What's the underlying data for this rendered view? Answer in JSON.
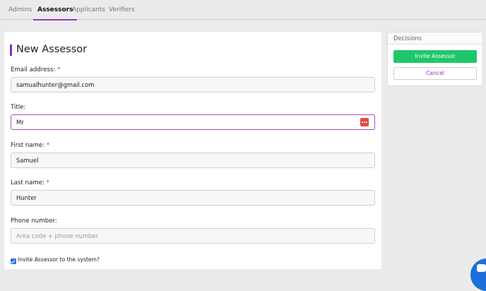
{
  "tabs": [
    {
      "label": "Admins"
    },
    {
      "label": "Assessors"
    },
    {
      "label": "Applicants"
    },
    {
      "label": "Verifiers"
    }
  ],
  "form": {
    "heading": "New Assessor",
    "required_marker": "*",
    "email": {
      "label": "Email address:",
      "value": "samualhunter@gmail.com"
    },
    "title": {
      "label": "Title:",
      "value": "Mr"
    },
    "first_name": {
      "label": "First name:",
      "value": "Samuel"
    },
    "last_name": {
      "label": "Last name:",
      "value": "Hunter"
    },
    "phone": {
      "label": "Phone number:",
      "value": "",
      "placeholder": "Area code + phone number"
    },
    "invite_checkbox": {
      "label": "Invite Assessor to the system?",
      "checked": true
    }
  },
  "decisions": {
    "title": "Decisions",
    "invite_label": "Invite Assessor",
    "cancel_label": "Cancel"
  },
  "colors": {
    "accent": "#9b30c9",
    "primary_button": "#1fc76a",
    "chat_widget": "#1e6fd9"
  },
  "icons": {
    "title_field_icon": "dots-icon",
    "chat_widget": "chat-icon"
  }
}
